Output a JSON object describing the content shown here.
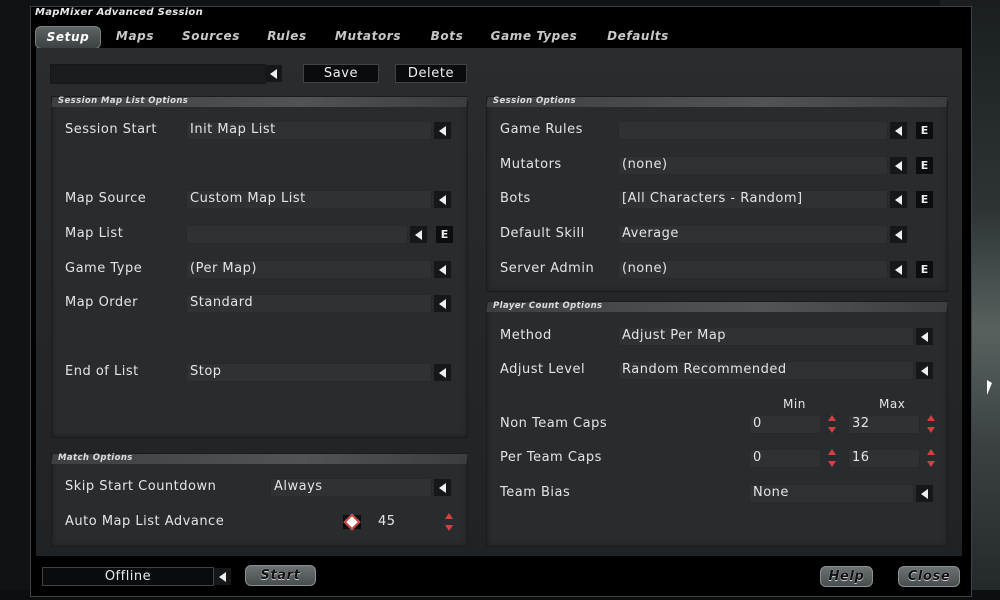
{
  "window": {
    "title": "MapMixer Advanced Session"
  },
  "tabs": [
    "Setup",
    "Maps",
    "Sources",
    "Rules",
    "Mutators",
    "Bots",
    "Game Types",
    "Defaults"
  ],
  "toolbar": {
    "session_name": "",
    "save_label": "Save",
    "delete_label": "Delete"
  },
  "session_map_list": {
    "title": "Session Map List Options",
    "rows": [
      {
        "label": "Session Start",
        "value": "Init Map List"
      },
      {
        "label": "Map Source",
        "value": "Custom Map List"
      },
      {
        "label": "Map List",
        "value": "",
        "edit": "E"
      },
      {
        "label": "Game Type",
        "value": "(Per Map)"
      },
      {
        "label": "Map Order",
        "value": "Standard"
      },
      {
        "label": "End of List",
        "value": "Stop"
      }
    ]
  },
  "match_options": {
    "title": "Match Options",
    "skip_start_countdown": {
      "label": "Skip Start Countdown",
      "value": "Always"
    },
    "auto_map_list_advance": {
      "label": "Auto Map List Advance",
      "value": "45"
    }
  },
  "session_options": {
    "title": "Session Options",
    "rows": [
      {
        "label": "Game Rules",
        "value": "",
        "edit": "E"
      },
      {
        "label": "Mutators",
        "value": "(none)",
        "edit": "E"
      },
      {
        "label": "Bots",
        "value": "[All Characters - Random]",
        "edit": "E"
      },
      {
        "label": "Default Skill",
        "value": "Average"
      },
      {
        "label": "Server Admin",
        "value": "(none)",
        "edit": "E"
      }
    ]
  },
  "player_count": {
    "title": "Player Count Options",
    "method": {
      "label": "Method",
      "value": "Adjust Per Map"
    },
    "adjust_level": {
      "label": "Adjust Level",
      "value": "Random Recommended"
    },
    "min_label": "Min",
    "max_label": "Max",
    "non_team_caps": {
      "label": "Non Team Caps",
      "min": "0",
      "max": "32"
    },
    "per_team_caps": {
      "label": "Per Team Caps",
      "min": "0",
      "max": "16"
    },
    "team_bias": {
      "label": "Team Bias",
      "value": "None"
    }
  },
  "footer": {
    "status": "Offline",
    "start_label": "Start",
    "help_label": "Help",
    "close_label": "Close"
  },
  "colors": {
    "spinner_arrow": "#d24040",
    "panel": "#292c2e",
    "tab_active": "#4e5454"
  }
}
